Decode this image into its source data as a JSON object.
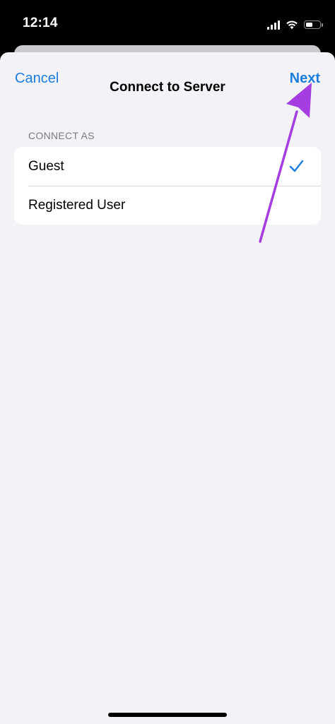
{
  "status_bar": {
    "time": "12:14",
    "icons": [
      "signal-icon",
      "wifi-icon",
      "battery-icon"
    ],
    "battery_level_percent": 55
  },
  "nav": {
    "cancel_label": "Cancel",
    "title": "Connect to Server",
    "next_label": "Next"
  },
  "section": {
    "header": "CONNECT AS",
    "items": [
      {
        "label": "Guest",
        "selected": true
      },
      {
        "label": "Registered User",
        "selected": false
      }
    ]
  },
  "colors": {
    "accent": "#1a7de0",
    "annotation_arrow": "#a63de0",
    "sheet_background": "#f2f2f7"
  }
}
